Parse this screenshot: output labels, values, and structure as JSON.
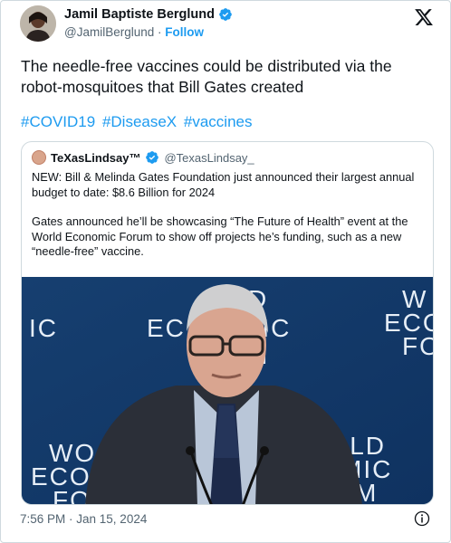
{
  "author": {
    "display_name": "Jamil Baptiste Berglund",
    "handle": "@JamilBerglund",
    "separator": "·",
    "follow_label": "Follow"
  },
  "tweet": {
    "text": "The needle-free vaccines could be distributed via the robot-mosquitoes that Bill Gates created",
    "hashtags": [
      "#COVID19",
      "#DiseaseX",
      "#vaccines"
    ]
  },
  "quote": {
    "display_name": "TeXasLindsay™",
    "handle": "@TexasLindsay_",
    "paragraph1": "NEW: Bill & Melinda Gates Foundation just announced their largest annual budget to date: $8.6 Billion for 2024",
    "paragraph2": "Gates announced he’ll be showcasing “The Future of Health” event at the World Economic Forum to show off projects he’s funding, such as a new “needle-free” vaccine.",
    "media": {
      "backdrop_left": [
        "IC"
      ],
      "backdrop_center": [
        "D",
        "EC",
        "MIC",
        "M"
      ],
      "backdrop_right_top": [
        "W",
        "ECO",
        "FO"
      ],
      "backdrop_left_bottom": [
        "WO",
        "ECON",
        "FO"
      ],
      "backdrop_right_bottom": [
        "RLD",
        "MIC",
        "M"
      ]
    }
  },
  "footer": {
    "timestamp": "7:56 PM · Jan 15, 2024"
  },
  "colors": {
    "accent": "#1d9bf0",
    "text": "#0f1419",
    "muted": "#536471",
    "border": "#cfd9de",
    "media_bg": "#123a6a"
  }
}
